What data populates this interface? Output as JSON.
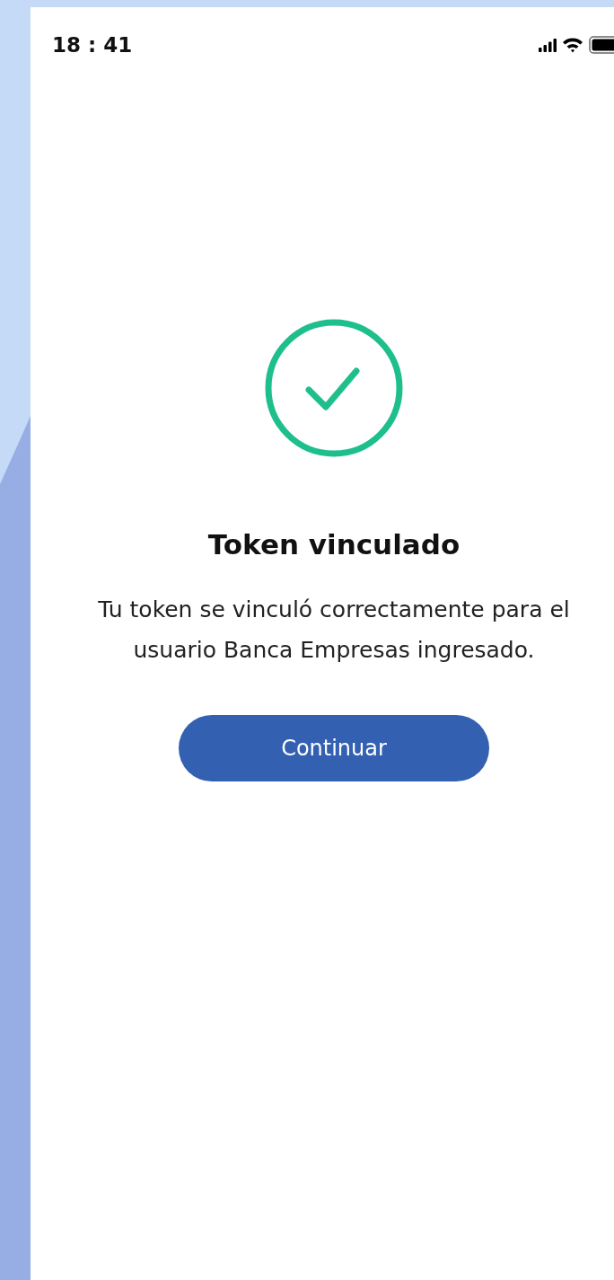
{
  "status_bar": {
    "time": "18 : 41"
  },
  "title": "Token vinculado",
  "message": "Tu token se vinculó correctamente para el usuario Banca Empresas ingresado.",
  "button": {
    "label": "Continuar"
  }
}
